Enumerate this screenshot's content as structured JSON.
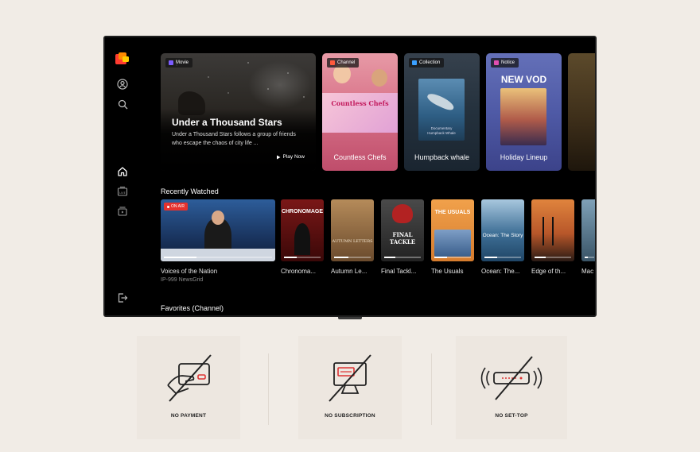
{
  "hero": [
    {
      "badge": "Movie",
      "badge_color": "#7c5cff",
      "title": "Under a Thousand Stars",
      "description": "Under a Thousand Stars follows a group of friends who escape the chaos of city life ...",
      "action": "Play Now"
    },
    {
      "badge": "Channel",
      "badge_color": "#ff5a3c",
      "poster_title": "Countless Chefs",
      "caption": "Countless Chefs"
    },
    {
      "badge": "Collection",
      "badge_color": "#3aa0ff",
      "poster_sub": "Documentary\nHumpback Whale",
      "caption": "Humpback whale"
    },
    {
      "badge": "Notice",
      "badge_color": "#e04fb0",
      "headline": "NEW VOD",
      "caption": "Holiday Lineup"
    }
  ],
  "recently_watched": {
    "title": "Recently Watched",
    "on_air_label": "ON AIR",
    "items": [
      {
        "label": "Voices of the Nation",
        "sub": "IP-999 NewsGrid",
        "progress": 0.3
      },
      {
        "label": "Chronoma...",
        "poster_text": "CHRONOMAGE",
        "progress": 0.35
      },
      {
        "label": "Autumn Le...",
        "poster_text": "AUTUMN LETTERS",
        "progress": 0.4
      },
      {
        "label": "Final Tackl...",
        "poster_text": "FINAL TACKLE",
        "progress": 0.3
      },
      {
        "label": "The Usuals",
        "poster_text": "THE USUALS",
        "progress": 0.35
      },
      {
        "label": "Ocean: The...",
        "poster_text": "Ocean: The Story",
        "progress": 0.35
      },
      {
        "label": "Edge of th...",
        "progress": 0.3
      },
      {
        "label": "Mac",
        "progress": 0.3
      }
    ]
  },
  "favorites_title": "Favorites (Channel)",
  "features": [
    {
      "label": "NO PAYMENT",
      "icon": "card-payment-icon"
    },
    {
      "label": "NO SUBSCRIPTION",
      "icon": "monitor-subscription-icon"
    },
    {
      "label": "NO SET-TOP",
      "icon": "set-top-box-icon"
    }
  ],
  "colors": {
    "accent_logo": "#ff3b30",
    "on_air": "#e5322e",
    "background": "#f1ece6"
  }
}
